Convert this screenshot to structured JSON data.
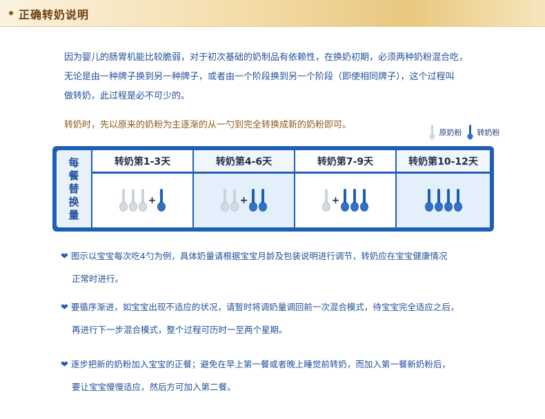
{
  "header": {
    "title": "正确转奶说明"
  },
  "intro": {
    "lines": [
      "因为婴儿的肠胃机能比较脆弱，对于初次基础的奶制品有依赖性，在换奶初期，必须两种奶粉混合吃，",
      "无论是由一种牌子换到另一种牌子，或者由一个阶段换到另一个阶段（即使相同牌子），这个过程叫",
      "做转奶，此过程是必不可少的。"
    ],
    "note": "转奶时，先以原来的奶粉为主逐渐的从一勺到完全转换成新的奶粉即可。"
  },
  "legend": {
    "original": "原奶粉",
    "new": "转奶粉"
  },
  "table": {
    "side_label": [
      "每",
      "餐",
      "替",
      "换",
      "量"
    ],
    "columns": [
      {
        "title": "转奶第1-3天",
        "original_spoons": 3,
        "new_spoons": 1
      },
      {
        "title": "转奶第4-6天",
        "original_spoons": 2,
        "new_spoons": 2
      },
      {
        "title": "转奶第7-9天",
        "original_spoons": 1,
        "new_spoons": 3
      },
      {
        "title": "转奶第10-12天",
        "original_spoons": 0,
        "new_spoons": 4
      }
    ]
  },
  "bullets": [
    {
      "line1": "图示以宝宝每次吃4勺为例，具体奶量请根据宝宝月龄及包装说明进行调节，转奶应在宝宝健康情况",
      "line2": "正常时进行。"
    },
    {
      "line1": "要循序渐进，如宝宝出现不适应的状况，请暂时将调奶量调回前一次混合模式，待宝宝完全适应之后，",
      "line2": "再进行下一步混合模式，整个过程可历时一至两个星期。"
    },
    {
      "line1": "逐步把新的奶粉加入宝宝的正餐；避免在早上第一餐或者晚上睡觉前转奶，而加入第一餐新奶粉后，",
      "line2": "要让宝宝慢慢适应，然后方可加入第二餐。"
    }
  ],
  "colors": {
    "accent": "#1e5fb6",
    "header_text": "#6b3d0c",
    "note_text": "#8c5a1c"
  }
}
